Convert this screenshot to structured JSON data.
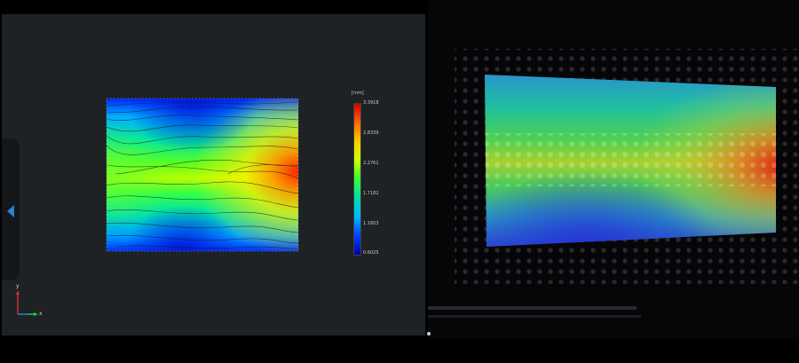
{
  "viewer": {
    "colorbar": {
      "unit": "[mm]",
      "ticks": [
        "3.3918",
        "2.8339",
        "2.2761",
        "1.7182",
        "1.1603",
        "0.6025"
      ],
      "colors": [
        "#d80000",
        "#ff6600",
        "#ffcc00",
        "#ccff00",
        "#33ff33",
        "#00ddaa",
        "#00b8ff",
        "#0040ff",
        "#0000b0"
      ]
    },
    "axes": {
      "y": "y",
      "x": "x"
    },
    "heatmap": {
      "min": 0.6025,
      "max": 3.3918
    }
  },
  "icons": {
    "collapse": "chevron-left-icon"
  }
}
